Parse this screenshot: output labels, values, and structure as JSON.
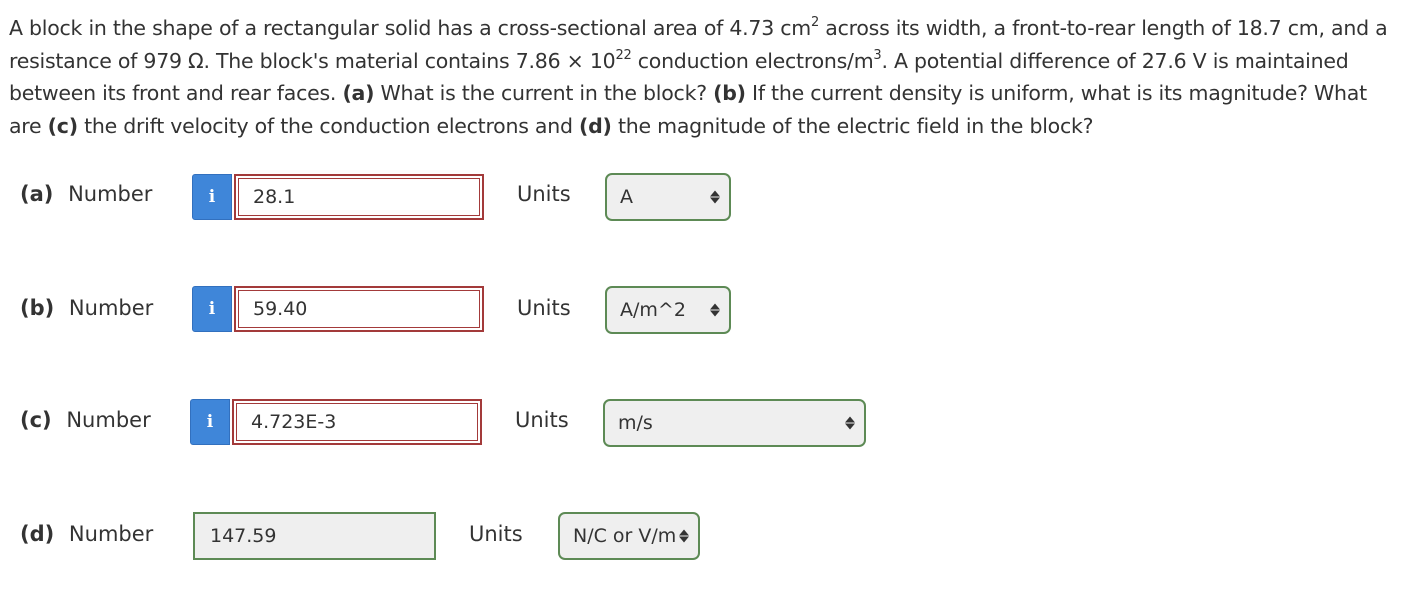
{
  "question": {
    "p1": "A block in the shape of a rectangular solid has a cross-sectional area of 4.73 cm",
    "p1_sup": "2",
    "p2": " across its width, a front-to-rear length of 18.7 cm, and a resistance of 979 Ω. The block's material contains 7.86 × 10",
    "p2_sup": "22",
    "p3": " conduction electrons/m",
    "p3_sup": "3",
    "p4": ". A potential difference of 27.6 V is maintained between its front and rear faces. ",
    "a_tag": "(a)",
    "a_text": " What is the current in the block? ",
    "b_tag": "(b)",
    "b_text": " If the current density is uniform, what is its magnitude? What are ",
    "c_tag": "(c)",
    "c_text": " the drift velocity of the conduction electrons and ",
    "d_tag": "(d)",
    "d_text": " the magnitude of the electric field in the block?"
  },
  "parts": [
    {
      "tag": "(a)",
      "number_label": "Number",
      "info_icon": "i",
      "value": "28.1",
      "units_label": "Units",
      "unit": "A"
    },
    {
      "tag": "(b)",
      "number_label": "Number",
      "info_icon": "i",
      "value": "59.40",
      "units_label": "Units",
      "unit": "A/m^2"
    },
    {
      "tag": "(c)",
      "number_label": "Number",
      "info_icon": "i",
      "value": "4.723E-3",
      "units_label": "Units",
      "unit": "m/s"
    },
    {
      "tag": "(d)",
      "number_label": "Number",
      "value": "147.59",
      "units_label": "Units",
      "unit": "N/C or V/m"
    }
  ],
  "colors": {
    "info_button": "#3f86d9",
    "incorrect_border": "#a33a3a",
    "correct_border": "#5d8a55",
    "select_background": "#efefef"
  }
}
